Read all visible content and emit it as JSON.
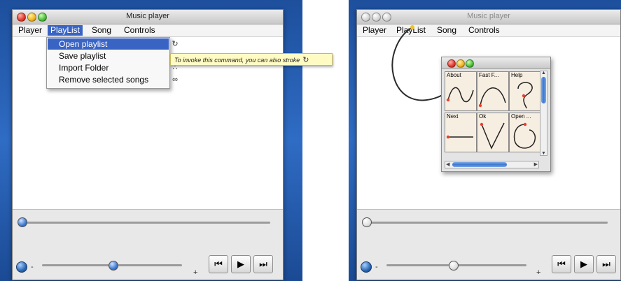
{
  "left": {
    "window_title": "Music player",
    "menu": [
      "Player",
      "PlayList",
      "Song",
      "Controls"
    ],
    "selected_menu_index": 1,
    "dropdown": [
      {
        "label": "Open playlist",
        "gesture_icon": "circle-arrow-gesture-icon",
        "glyph": "↻"
      },
      {
        "label": "Save playlist",
        "gesture_icon": "gesture-icon",
        "glyph": ""
      },
      {
        "label": "Import Folder",
        "gesture_icon": "dots-gesture-icon",
        "glyph": "∴"
      },
      {
        "label": "Remove selected songs",
        "gesture_icon": "loop-gesture-icon",
        "glyph": "∞"
      }
    ],
    "tooltip": "To invoke this command, you can also stroke",
    "tooltip_icon_glyph": "↻",
    "seek_fraction": 0.0,
    "volume_fraction": 0.5
  },
  "right": {
    "window_title": "Music player",
    "menu": [
      "Player",
      "PlayList",
      "Song",
      "Controls"
    ],
    "seek_fraction": 0.0,
    "volume_fraction": 0.45,
    "gestures": [
      "About",
      "Fast F...",
      "Help",
      "Next",
      "Ok",
      "Open ..."
    ]
  },
  "controls": {
    "volume_minus": "-",
    "volume_plus": "+",
    "prev": "⏮",
    "play": "▶",
    "next": "⏭"
  },
  "colors": {
    "menu_highlight": "#3a64c4",
    "tooltip_bg": "#fffbc2",
    "desktop_blue": "#2f6cc4",
    "gesture_red": "#e8412e"
  }
}
